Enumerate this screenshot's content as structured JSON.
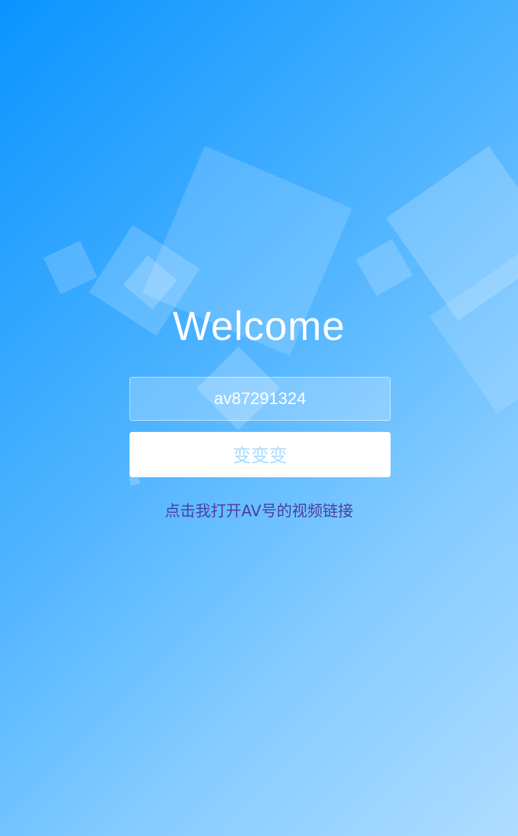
{
  "page": {
    "title": "Welcome"
  },
  "form": {
    "av_input_value": "av87291324",
    "submit_label": "变变变"
  },
  "link": {
    "open_video_label": "点击我打开AV号的视频链接"
  },
  "colors": {
    "background_start": "#0a94ff",
    "background_end": "#aedcff",
    "button_text": "#a6dcff",
    "link_text": "#4a3fa0",
    "title_text": "#ffffff"
  }
}
